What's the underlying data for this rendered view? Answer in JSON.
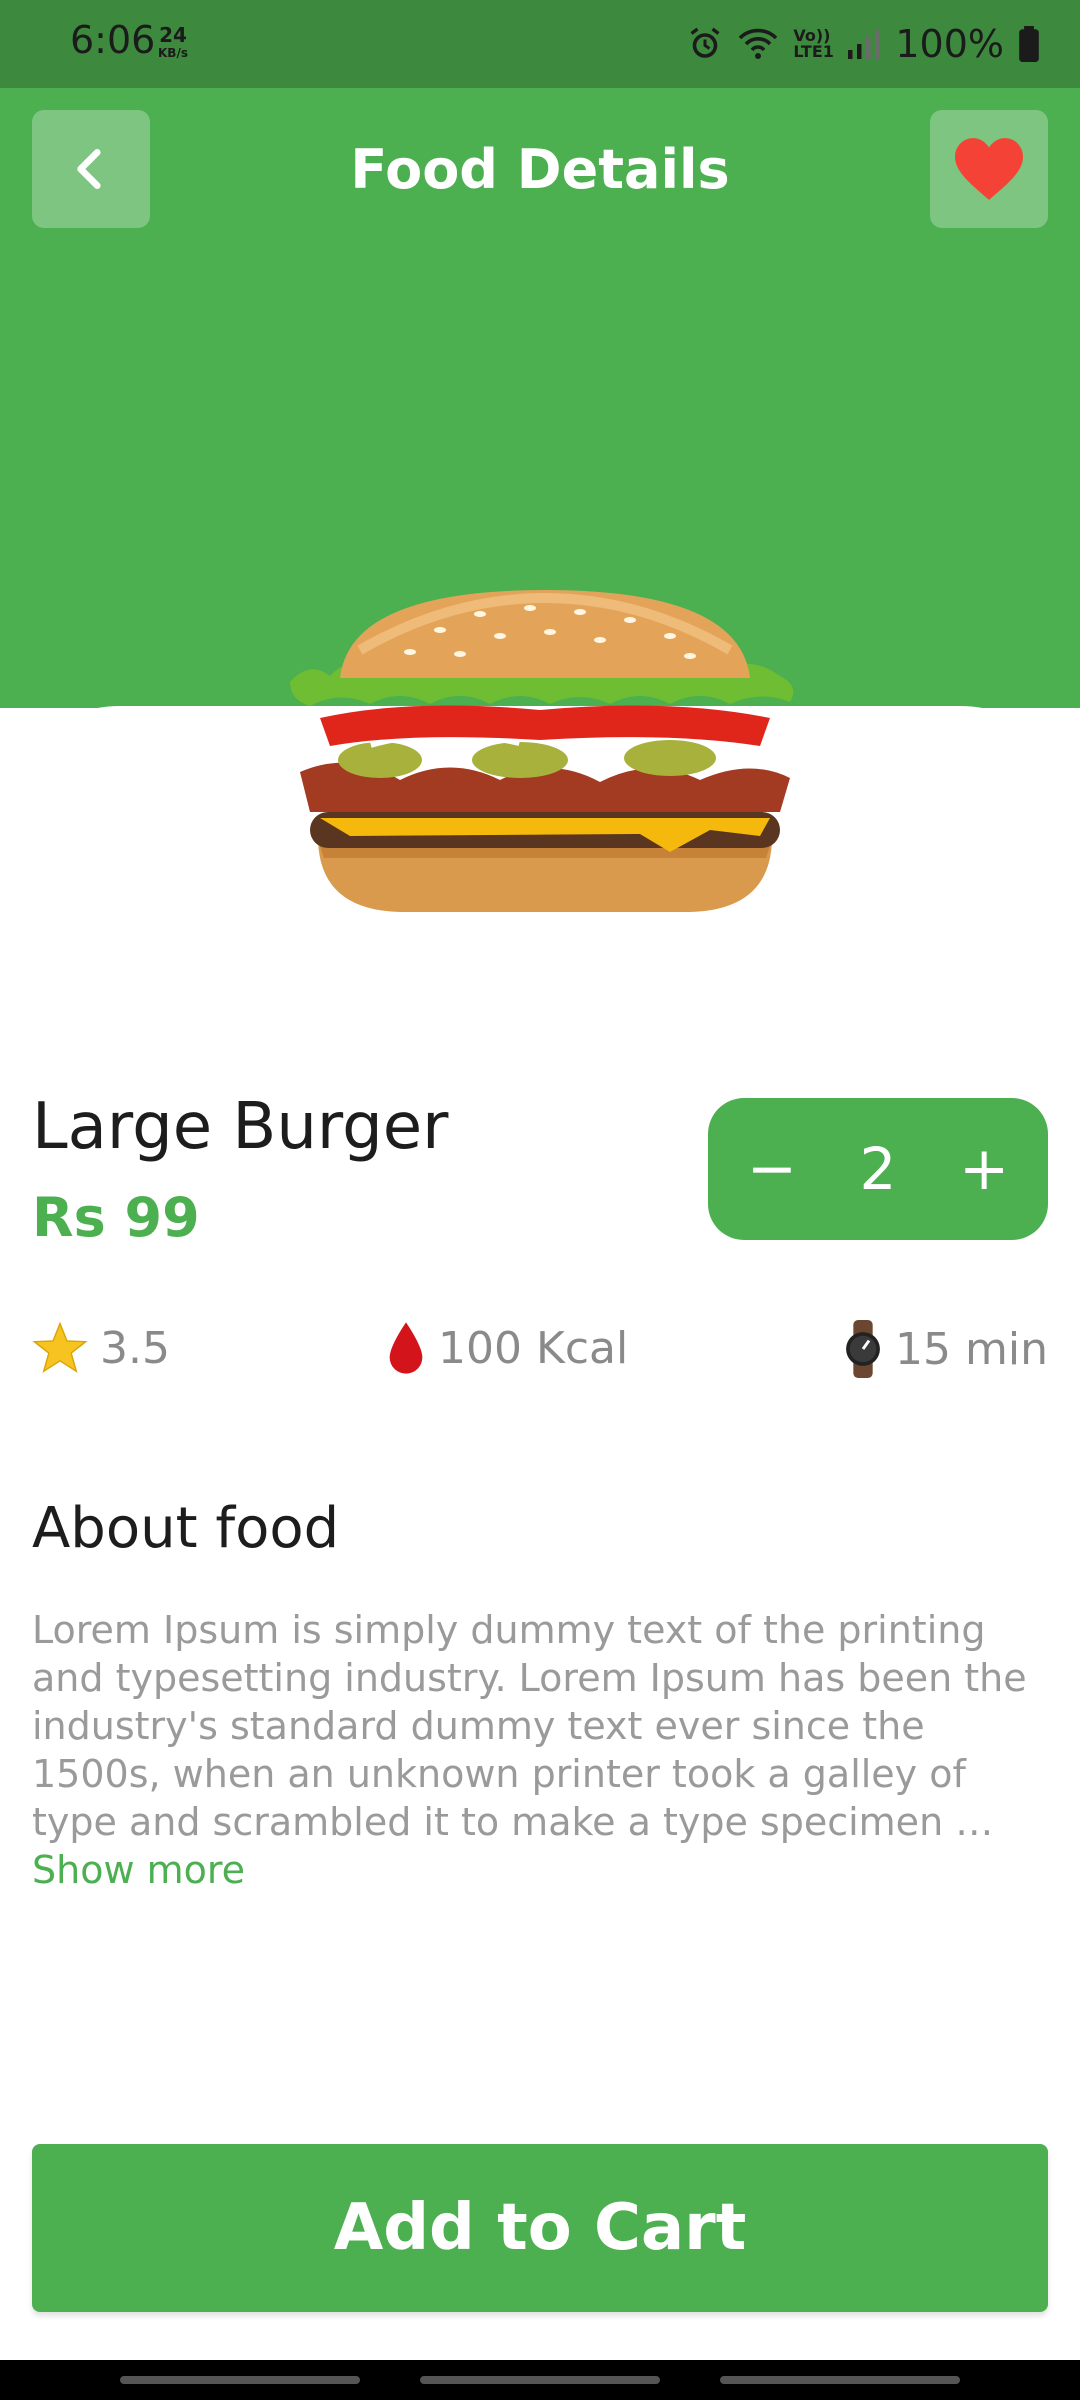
{
  "status_bar": {
    "time": "6:06",
    "net_speed_value": "24",
    "net_speed_unit": "KB/s",
    "lte_label": "Vo)) LTE1",
    "battery": "100%"
  },
  "header": {
    "title": "Food Details"
  },
  "food": {
    "name": "Large Burger",
    "price": "Rs 99",
    "quantity": "2",
    "minus_label": "−",
    "plus_label": "+"
  },
  "stats": {
    "rating": "3.5",
    "calories": "100 Kcal",
    "time": "15 min"
  },
  "about": {
    "title": "About food",
    "text": "Lorem Ipsum is simply dummy text of the printing and typesetting industry. Lorem Ipsum has been the industry's standard dummy text ever since the 1500s, when an unknown printer took a galley of type and scrambled it to make a type specimen … ",
    "show_more": "Show more"
  },
  "cta": {
    "label": "Add to Cart"
  },
  "colors": {
    "accent": "#4caf50",
    "status_bar": "#3d8a3f",
    "heart": "#f44336"
  },
  "icons": [
    "back-arrow-icon",
    "heart-icon",
    "star-icon",
    "drop-icon",
    "watch-icon",
    "alarm-icon",
    "wifi-icon",
    "signal-icon",
    "battery-icon"
  ]
}
